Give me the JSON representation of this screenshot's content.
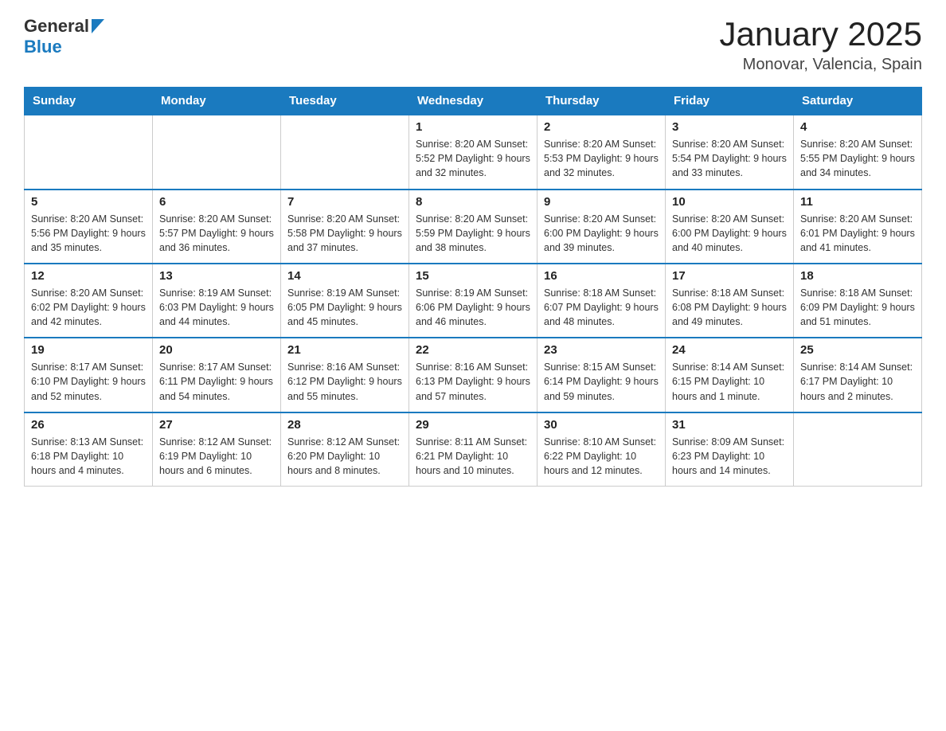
{
  "header": {
    "logo_general": "General",
    "logo_blue": "Blue",
    "title": "January 2025",
    "location": "Monovar, Valencia, Spain"
  },
  "calendar": {
    "weekdays": [
      "Sunday",
      "Monday",
      "Tuesday",
      "Wednesday",
      "Thursday",
      "Friday",
      "Saturday"
    ],
    "weeks": [
      [
        {
          "day": "",
          "info": ""
        },
        {
          "day": "",
          "info": ""
        },
        {
          "day": "",
          "info": ""
        },
        {
          "day": "1",
          "info": "Sunrise: 8:20 AM\nSunset: 5:52 PM\nDaylight: 9 hours and 32 minutes."
        },
        {
          "day": "2",
          "info": "Sunrise: 8:20 AM\nSunset: 5:53 PM\nDaylight: 9 hours and 32 minutes."
        },
        {
          "day": "3",
          "info": "Sunrise: 8:20 AM\nSunset: 5:54 PM\nDaylight: 9 hours and 33 minutes."
        },
        {
          "day": "4",
          "info": "Sunrise: 8:20 AM\nSunset: 5:55 PM\nDaylight: 9 hours and 34 minutes."
        }
      ],
      [
        {
          "day": "5",
          "info": "Sunrise: 8:20 AM\nSunset: 5:56 PM\nDaylight: 9 hours and 35 minutes."
        },
        {
          "day": "6",
          "info": "Sunrise: 8:20 AM\nSunset: 5:57 PM\nDaylight: 9 hours and 36 minutes."
        },
        {
          "day": "7",
          "info": "Sunrise: 8:20 AM\nSunset: 5:58 PM\nDaylight: 9 hours and 37 minutes."
        },
        {
          "day": "8",
          "info": "Sunrise: 8:20 AM\nSunset: 5:59 PM\nDaylight: 9 hours and 38 minutes."
        },
        {
          "day": "9",
          "info": "Sunrise: 8:20 AM\nSunset: 6:00 PM\nDaylight: 9 hours and 39 minutes."
        },
        {
          "day": "10",
          "info": "Sunrise: 8:20 AM\nSunset: 6:00 PM\nDaylight: 9 hours and 40 minutes."
        },
        {
          "day": "11",
          "info": "Sunrise: 8:20 AM\nSunset: 6:01 PM\nDaylight: 9 hours and 41 minutes."
        }
      ],
      [
        {
          "day": "12",
          "info": "Sunrise: 8:20 AM\nSunset: 6:02 PM\nDaylight: 9 hours and 42 minutes."
        },
        {
          "day": "13",
          "info": "Sunrise: 8:19 AM\nSunset: 6:03 PM\nDaylight: 9 hours and 44 minutes."
        },
        {
          "day": "14",
          "info": "Sunrise: 8:19 AM\nSunset: 6:05 PM\nDaylight: 9 hours and 45 minutes."
        },
        {
          "day": "15",
          "info": "Sunrise: 8:19 AM\nSunset: 6:06 PM\nDaylight: 9 hours and 46 minutes."
        },
        {
          "day": "16",
          "info": "Sunrise: 8:18 AM\nSunset: 6:07 PM\nDaylight: 9 hours and 48 minutes."
        },
        {
          "day": "17",
          "info": "Sunrise: 8:18 AM\nSunset: 6:08 PM\nDaylight: 9 hours and 49 minutes."
        },
        {
          "day": "18",
          "info": "Sunrise: 8:18 AM\nSunset: 6:09 PM\nDaylight: 9 hours and 51 minutes."
        }
      ],
      [
        {
          "day": "19",
          "info": "Sunrise: 8:17 AM\nSunset: 6:10 PM\nDaylight: 9 hours and 52 minutes."
        },
        {
          "day": "20",
          "info": "Sunrise: 8:17 AM\nSunset: 6:11 PM\nDaylight: 9 hours and 54 minutes."
        },
        {
          "day": "21",
          "info": "Sunrise: 8:16 AM\nSunset: 6:12 PM\nDaylight: 9 hours and 55 minutes."
        },
        {
          "day": "22",
          "info": "Sunrise: 8:16 AM\nSunset: 6:13 PM\nDaylight: 9 hours and 57 minutes."
        },
        {
          "day": "23",
          "info": "Sunrise: 8:15 AM\nSunset: 6:14 PM\nDaylight: 9 hours and 59 minutes."
        },
        {
          "day": "24",
          "info": "Sunrise: 8:14 AM\nSunset: 6:15 PM\nDaylight: 10 hours and 1 minute."
        },
        {
          "day": "25",
          "info": "Sunrise: 8:14 AM\nSunset: 6:17 PM\nDaylight: 10 hours and 2 minutes."
        }
      ],
      [
        {
          "day": "26",
          "info": "Sunrise: 8:13 AM\nSunset: 6:18 PM\nDaylight: 10 hours and 4 minutes."
        },
        {
          "day": "27",
          "info": "Sunrise: 8:12 AM\nSunset: 6:19 PM\nDaylight: 10 hours and 6 minutes."
        },
        {
          "day": "28",
          "info": "Sunrise: 8:12 AM\nSunset: 6:20 PM\nDaylight: 10 hours and 8 minutes."
        },
        {
          "day": "29",
          "info": "Sunrise: 8:11 AM\nSunset: 6:21 PM\nDaylight: 10 hours and 10 minutes."
        },
        {
          "day": "30",
          "info": "Sunrise: 8:10 AM\nSunset: 6:22 PM\nDaylight: 10 hours and 12 minutes."
        },
        {
          "day": "31",
          "info": "Sunrise: 8:09 AM\nSunset: 6:23 PM\nDaylight: 10 hours and 14 minutes."
        },
        {
          "day": "",
          "info": ""
        }
      ]
    ]
  }
}
